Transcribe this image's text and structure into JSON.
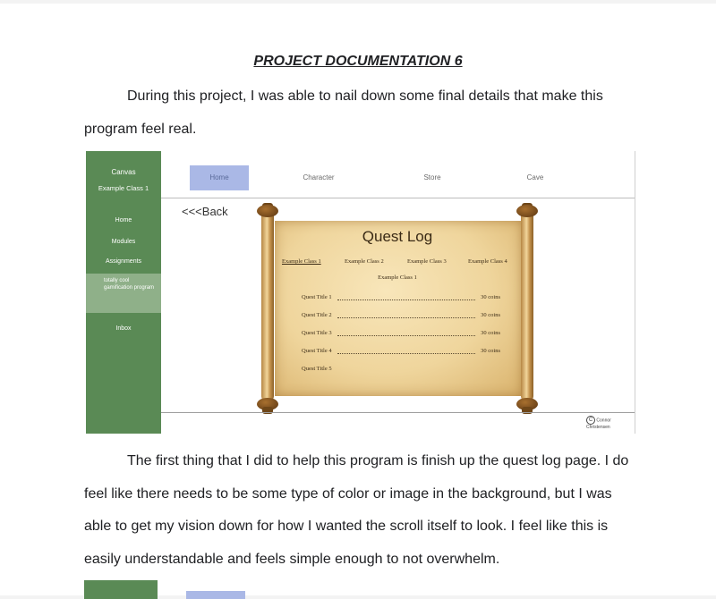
{
  "document": {
    "title": "PROJECT DOCUMENTATION 6",
    "intro_line1": "During this project, I was able to nail down some final details that make this",
    "intro_line2": "program feel real.",
    "body_line1": "The first thing that I did to help this program is finish up the quest log page.  I do",
    "body_line2": "feel like there needs to be some type of color or image in the background, but I was",
    "body_line3": "able to get my vision down for how I wanted the scroll itself to look. I feel like this is",
    "body_line4": "easily understandable and feels simple enough to not overwhelm."
  },
  "screenshot": {
    "sidebar": {
      "app_name": "Canvas",
      "course_name": "Example Class 1",
      "items": [
        "Home",
        "Modules",
        "Assignments",
        "totally cool gamification program",
        "Inbox"
      ]
    },
    "tabs": [
      "Home",
      "Character",
      "Store",
      "Cave"
    ],
    "back_label": "<<<Back",
    "quest_log": {
      "title": "Quest Log",
      "classes": [
        "Example Class 1",
        "Example Class 2",
        "Example Class 3",
        "Example Class 4"
      ],
      "selected_class": "Example Class 1",
      "quests": [
        {
          "name": "Quest Title 1",
          "reward": "30 coins"
        },
        {
          "name": "Quest Title 2",
          "reward": "30 coins"
        },
        {
          "name": "Quest Title 3",
          "reward": "30 coins"
        },
        {
          "name": "Quest Title 4",
          "reward": "30 coins"
        },
        {
          "name": "Quest Title 5",
          "reward": ""
        }
      ]
    },
    "copyright_symbol": "C",
    "copyright_text": "Connor Christensen"
  },
  "colors": {
    "sidebar_green": "#5a8a55",
    "sidebar_highlight": "#8fb089",
    "tab_active": "#aab8e6",
    "parchment": "#efd59c"
  }
}
